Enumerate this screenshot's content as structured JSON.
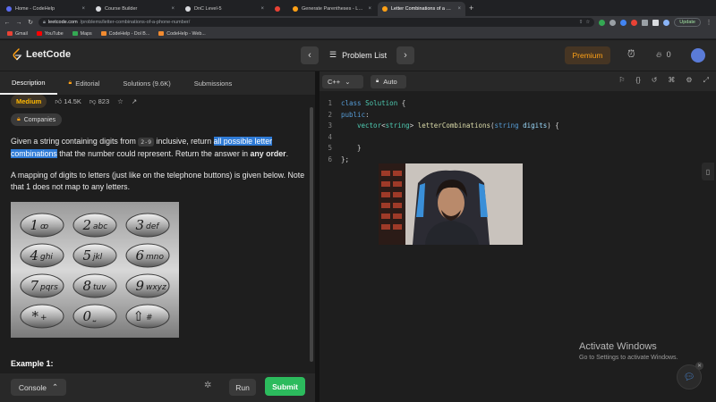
{
  "browser": {
    "tabs": [
      {
        "label": "Home - CodeHelp",
        "color": "#5b6cf0",
        "active": false
      },
      {
        "label": "Course Builder",
        "color": "#dadce0",
        "active": false
      },
      {
        "label": "DnC Level-5",
        "color": "#dadce0",
        "active": false
      },
      {
        "label": "",
        "color": "#e94235",
        "active": false
      },
      {
        "label": "Generate Parentheses - LeetC",
        "color": "#ffa116",
        "active": false
      },
      {
        "label": "Letter Combinations of a Phon",
        "color": "#ffa116",
        "active": true
      }
    ],
    "url_host": "leetcode.com",
    "url_path": "/problems/letter-combinations-of-a-phone-number/",
    "update_label": "Update",
    "bookmarks": [
      "Gmail",
      "YouTube",
      "Maps",
      "CodeHelp - Dol B...",
      "CodeHelp - Web..."
    ]
  },
  "lc_nav": {
    "brand": "LeetCode",
    "problem_list": "Problem List",
    "premium": "Premium",
    "streak": "0"
  },
  "left": {
    "tabs": [
      "Description",
      "Editorial",
      "Solutions (9.6K)",
      "Submissions"
    ],
    "difficulty": "Medium",
    "likes": "14.5K",
    "dislikes": "823",
    "companies": "Companies",
    "desc1": {
      "pre": "Given a string containing digits from ",
      "code": "2-9",
      "mid": " inclusive, return ",
      "highlight": "all possible letter combinations",
      "post": " that the number could represent. Return the answer in ",
      "bold": "any order",
      "end": "."
    },
    "desc2": "A mapping of digits to letters (just like on the telephone buttons) is given below. Note that 1 does not map to any letters.",
    "keypad": [
      {
        "digit": "1",
        "letters": "ꝏ"
      },
      {
        "digit": "2",
        "letters": "abc"
      },
      {
        "digit": "3",
        "letters": "def"
      },
      {
        "digit": "4",
        "letters": "ghi"
      },
      {
        "digit": "5",
        "letters": "jkl"
      },
      {
        "digit": "6",
        "letters": "mno"
      },
      {
        "digit": "7",
        "letters": "pqrs"
      },
      {
        "digit": "8",
        "letters": "tuv"
      },
      {
        "digit": "9",
        "letters": "wxyz"
      },
      {
        "digit": "*",
        "letters": "+"
      },
      {
        "digit": "0",
        "letters": "⎵"
      },
      {
        "digit": "⇧",
        "letters": "#"
      }
    ],
    "example_title": "Example 1:",
    "console": "Console",
    "run": "Run",
    "submit": "Submit"
  },
  "editor": {
    "language": "C++",
    "mode": "Auto",
    "lines": [
      "1",
      "2",
      "3",
      "4",
      "5",
      "6"
    ]
  },
  "watermark": {
    "title": "Activate Windows",
    "sub": "Go to Settings to activate Windows."
  }
}
